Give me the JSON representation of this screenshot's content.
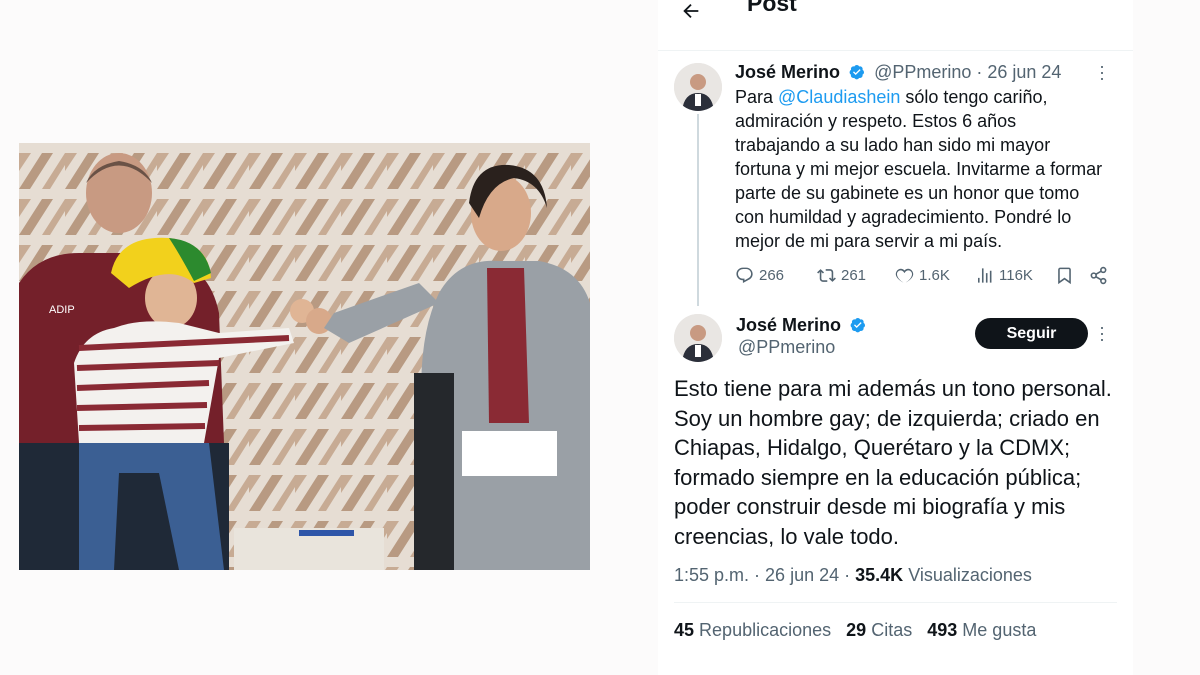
{
  "header": {
    "back_icon": "arrow-left-icon",
    "title": "Post"
  },
  "reply_post": {
    "author_name": "José Merino",
    "handle_date": "@PPmerino · 26 jun 24",
    "text_prefix": "Para ",
    "mention": "@Claudiashein",
    "text_rest": " sólo tengo cariño, admiración y respeto. Estos 6 años trabajando a su lado han sido mi mayor fortuna y mi mejor escuela. Invitarme a formar parte de su gabinete es un honor que tomo con humildad y agradecimiento. Pondré lo mejor de mi para servir a mi país.",
    "replies": "266",
    "reposts": "261",
    "likes": "1.6K",
    "views": "116K"
  },
  "main_post": {
    "author_name": "José Merino",
    "handle": "@PPmerino",
    "follow_label": "Seguir",
    "text": "Esto tiene para mi además un tono personal. Soy un hombre gay; de izquierda; criado en Chiapas, Hidalgo, Querétaro y la CDMX; formado siempre en la educación pública; poder construir desde mi biografía y mis creencias, lo vale todo.",
    "time": "1:55 p.m.",
    "date": "26 jun 24",
    "views_count": "35.4K",
    "views_label": "Visualizaciones",
    "reposts_count": "45",
    "reposts_label": "Republicaciones",
    "quotes_count": "29",
    "quotes_label": "Citas",
    "likes_count": "493",
    "likes_label": "Me gusta"
  },
  "photo": {
    "vest_text": "ADIP"
  },
  "colors": {
    "accent": "#1d9bf0",
    "text": "#0f1419",
    "muted": "#536471"
  }
}
